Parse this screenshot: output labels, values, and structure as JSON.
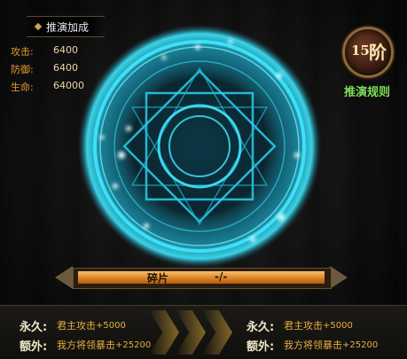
{
  "header": {
    "title": "推演加成"
  },
  "stats": [
    {
      "label": "攻击:",
      "value": "6400"
    },
    {
      "label": "防御:",
      "value": "6400"
    },
    {
      "label": "生命:",
      "value": "64000"
    }
  ],
  "level": {
    "number": "15",
    "unit": "阶"
  },
  "rules_link": "推演规则",
  "progress": {
    "label": "碎片",
    "value": "-/-",
    "fill_fraction": 1.0
  },
  "bonuses_left": [
    {
      "key": "永久:",
      "text": "君主攻击",
      "amount": "+5000"
    },
    {
      "key": "额外:",
      "text": "我方将领暴击",
      "amount": "+25200"
    }
  ],
  "bonuses_right": [
    {
      "key": "永久:",
      "text": "君主攻击",
      "amount": "+5000"
    },
    {
      "key": "额外:",
      "text": "我方将领暴击",
      "amount": "+25200"
    }
  ],
  "colors": {
    "accent_orange": "#e89a2c",
    "stat_value": "#ecd7a4",
    "rules_green": "#7fe05a",
    "circle_cyan": "#3fe8ff",
    "bar_orange": "#e08a2a"
  }
}
